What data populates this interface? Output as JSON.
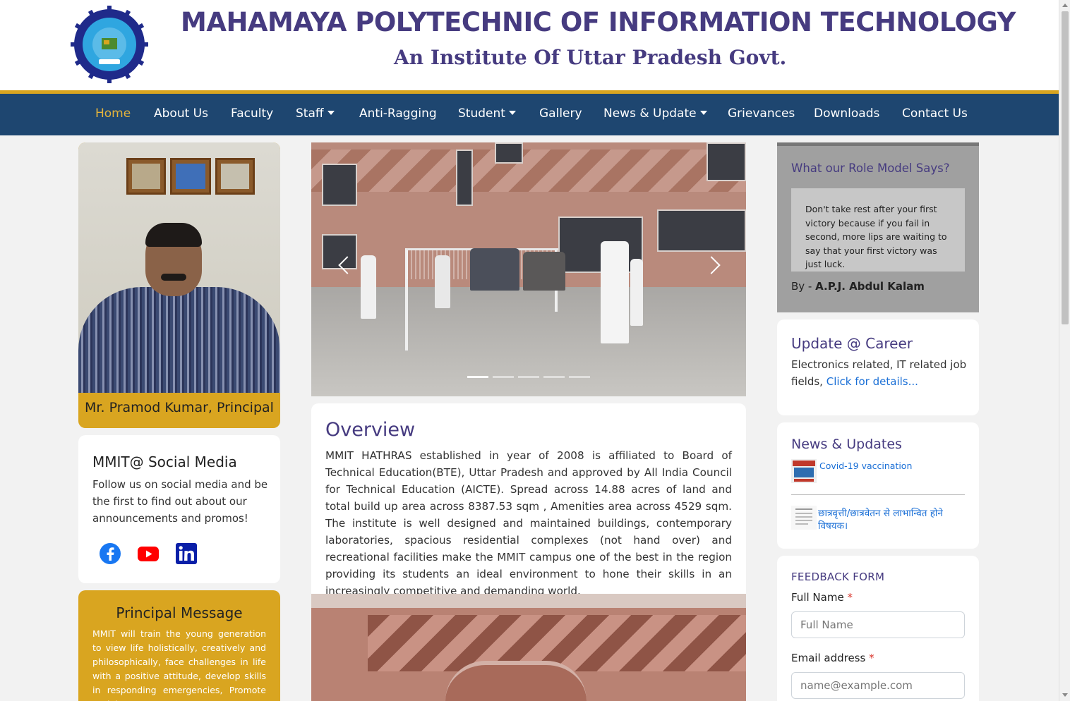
{
  "header": {
    "title": "MAHAMAYA POLYTECHNIC OF INFORMATION TECHNOLOGY",
    "subtitle": "An Institute Of Uttar Pradesh Govt."
  },
  "nav": {
    "items": [
      {
        "label": "Home",
        "active": true,
        "dropdown": false
      },
      {
        "label": "About Us",
        "dropdown": false
      },
      {
        "label": "Faculty",
        "dropdown": false
      },
      {
        "label": "Staff",
        "dropdown": true
      },
      {
        "label": "Anti-Ragging",
        "dropdown": false
      },
      {
        "label": "Student",
        "dropdown": true
      },
      {
        "label": "Gallery",
        "dropdown": false
      },
      {
        "label": "News & Update",
        "dropdown": true
      },
      {
        "label": "Grievances",
        "dropdown": false
      },
      {
        "label": "Downloads",
        "dropdown": false
      },
      {
        "label": "Contact Us",
        "dropdown": false
      }
    ]
  },
  "principal": {
    "caption": "Mr. Pramod Kumar, Principal"
  },
  "social": {
    "title": "MMIT@ Social Media",
    "text": "Follow us on social media and be the first to find out about our announcements and promos!",
    "icons": [
      "facebook-icon",
      "youtube-icon",
      "linkedin-icon"
    ]
  },
  "principal_message": {
    "title": "Principal Message",
    "text": "MMIT will train the young generation to view life holistically, creatively and philosophically, face challenges in life with a positive attitude, develop skills in responding emergencies, Promote social"
  },
  "carousel": {
    "slide_count": 5,
    "active_index": 0
  },
  "overview": {
    "title": "Overview",
    "text": "MMIT HATHRAS established in year of 2008 is affiliated to Board of Technical Education(BTE), Uttar Pradesh and approved by All India Council for Technical Education (AICTE). Spread across 14.88 acres of land and total build up area across 8387.53 sqm , Amenities area across 4529 sqm. The institute is well designed and maintained buildings, contemporary laboratories, spacious residential complexes (not hand over) and recreational facilities make the MMIT campus one of the best in the region providing its students an ideal environment to hone their skills in an increasingly competitive and demanding world."
  },
  "role_model": {
    "title": "What our Role Model Says?",
    "quote": "Don't take rest after your first victory because if you fail in second, more lips are waiting to say that your first victory was just luck.",
    "by_prefix": "By - ",
    "author": "A.P.J. Abdul Kalam"
  },
  "career": {
    "title": "Update @ Career",
    "text": "Electronics related, IT related job fields, ",
    "link": "Click for details..."
  },
  "news": {
    "title": "News & Updates",
    "items": [
      {
        "label": "Covid-19 vaccination"
      },
      {
        "label": "छात्रवृत्ती/छात्रवेतन से लाभान्वित होने विषयक।"
      }
    ]
  },
  "feedback": {
    "title": "FEEDBACK FORM",
    "name_label": "Full Name",
    "name_placeholder": "Full Name",
    "email_label": "Email address",
    "email_placeholder": "name@example.com",
    "required_mark": "*"
  },
  "colors": {
    "nav_bg": "#1e4670",
    "accent_gold": "#d9a520",
    "title_purple": "#463b80",
    "link_blue": "#1a6fd6"
  }
}
